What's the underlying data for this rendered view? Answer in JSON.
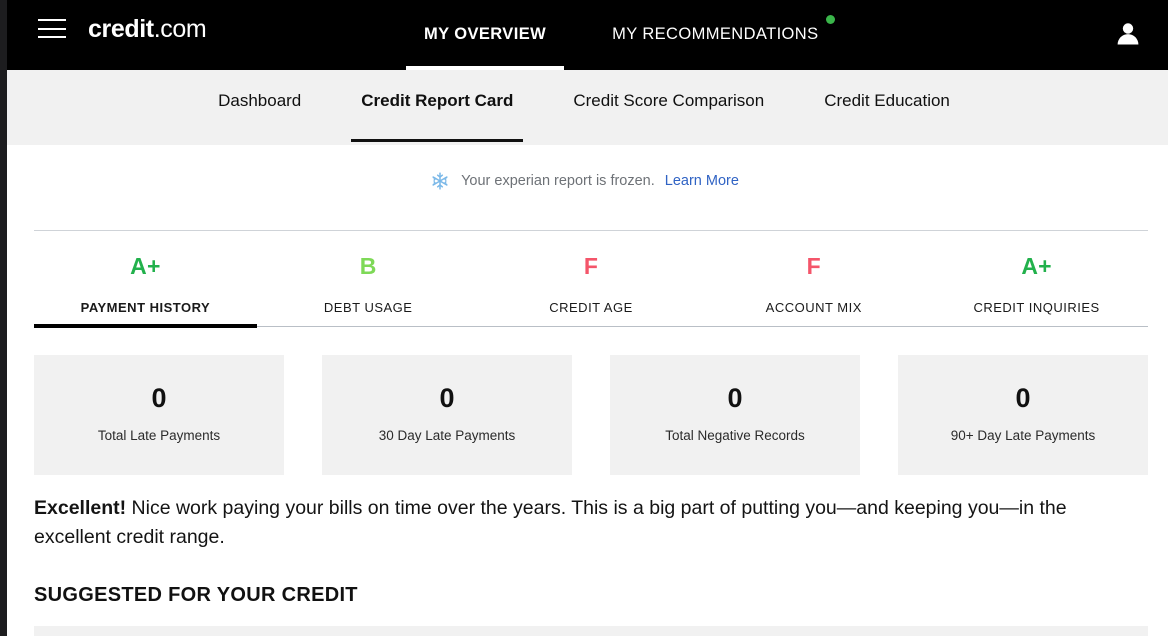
{
  "header": {
    "menu_icon": "hamburger-menu-icon",
    "brand_strong": "credit",
    "brand_light": ".com",
    "avatar_icon": "user-avatar-icon",
    "nav": [
      {
        "label": "MY OVERVIEW",
        "active": true,
        "badge": false
      },
      {
        "label": "MY RECOMMENDATIONS",
        "active": false,
        "badge": true
      }
    ],
    "badge_color": "#3ab54a"
  },
  "subnav": {
    "items": [
      {
        "label": "Dashboard",
        "active": false
      },
      {
        "label": "Credit Report Card",
        "active": true
      },
      {
        "label": "Credit Score Comparison",
        "active": false
      },
      {
        "label": "Credit Education",
        "active": false
      }
    ]
  },
  "notice": {
    "icon": "snowflake-icon",
    "icon_color": "#7ab8e8",
    "text": "Your experian report is frozen.",
    "link_label": "Learn More",
    "link_color": "#3063c4"
  },
  "grades": {
    "tabs": [
      {
        "letter": "A+",
        "name": "PAYMENT HISTORY",
        "color": "#22b14c",
        "active": true
      },
      {
        "letter": "B",
        "name": "DEBT USAGE",
        "color": "#7ed957",
        "active": false
      },
      {
        "letter": "F",
        "name": "CREDIT AGE",
        "color": "#f4556a",
        "active": false
      },
      {
        "letter": "F",
        "name": "ACCOUNT MIX",
        "color": "#f4556a",
        "active": false
      },
      {
        "letter": "A+",
        "name": "CREDIT INQUIRIES",
        "color": "#22b14c",
        "active": false
      }
    ]
  },
  "stats": {
    "cards": [
      {
        "value": "0",
        "label": "Total Late Payments"
      },
      {
        "value": "0",
        "label": "30 Day Late Payments"
      },
      {
        "value": "0",
        "label": "Total Negative Records"
      },
      {
        "value": "0",
        "label": "90+ Day Late Payments"
      }
    ]
  },
  "summary": {
    "lead": "Excellent!",
    "body": " Nice work paying your bills on time over the years. This is a big part of putting you—and keeping you—in the excellent credit range."
  },
  "suggested": {
    "heading": "SUGGESTED FOR YOUR CREDIT"
  }
}
